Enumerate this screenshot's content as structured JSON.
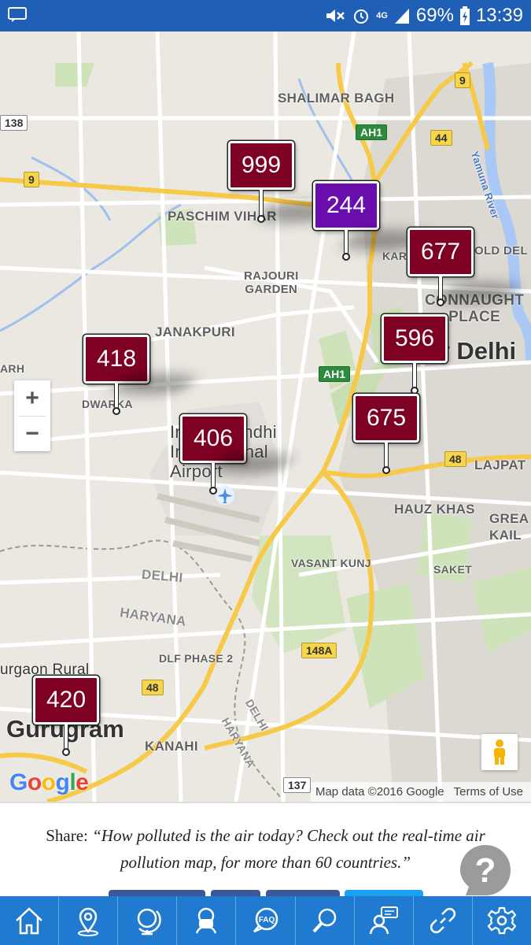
{
  "status_bar": {
    "network": "4G",
    "battery": "69%",
    "time": "13:39",
    "icons": [
      "notification-icon",
      "mute-icon",
      "alarm-icon",
      "signal-icon",
      "battery-charging-icon"
    ]
  },
  "map": {
    "places": {
      "shalimar_bagh": "SHALIMAR BAGH",
      "paschim_vihar": "PASCHIM VIHAR",
      "rajouri_garden": "RAJOURI\nGARDEN",
      "janakpuri": "JANAKPURI",
      "connaught_place": "CONNAUGHT\nPLACE",
      "new_delhi": "New Delhi",
      "dwarka": "DWARKA",
      "airport": "Indira Gandhi\nInternational\nAirport",
      "hauz_khas": "HAUZ KHAS",
      "greater_kailash": "GREA\nKAIL",
      "lajpat": "LAJPAT",
      "vasant_kunj": "VASANT KUNJ",
      "saket": "SAKET",
      "delhi": "DELHI",
      "haryana": "HARYANA",
      "dlf_phase_2": "DLF PHASE 2",
      "gurgaon_rural": "urgaon Rural",
      "gurugram": "Gurugram",
      "kanahi": "KANAHI",
      "delhi_diag": "DELHI",
      "haryana_diag": "HARYANA",
      "old_delhi": "OLD DEL",
      "karol": "KAR",
      "arh": "ARH",
      "yamuna_river": "Yamuna River"
    },
    "road_shields": {
      "r138": "138",
      "r9_left": "9",
      "r9_top": "9",
      "ah1_top": "AH1",
      "ah1_mid": "AH1",
      "r44": "44",
      "r48_right": "48",
      "r48_left": "48",
      "r148a": "148A",
      "r137": "137"
    },
    "aqi_markers": [
      {
        "value": "999",
        "color": "#7e0023"
      },
      {
        "value": "244",
        "color": "#6a0dad"
      },
      {
        "value": "677",
        "color": "#7e0023"
      },
      {
        "value": "596",
        "color": "#7e0023"
      },
      {
        "value": "418",
        "color": "#7e0023"
      },
      {
        "value": "406",
        "color": "#7e0023"
      },
      {
        "value": "675",
        "color": "#7e0023"
      },
      {
        "value": "420",
        "color": "#7e0023"
      }
    ],
    "zoom_in": "+",
    "zoom_out": "−",
    "google_logo": [
      "G",
      "o",
      "o",
      "g",
      "l",
      "e"
    ],
    "map_data": "Map data ©2016 Google",
    "terms": "Terms of Use"
  },
  "share": {
    "prefix": "Share: ",
    "quote": "“How polluted is the air today? Check out the real-time air pollution map, for more than 60 countries.”"
  },
  "help_icon": "?",
  "nav": [
    {
      "name": "home-icon"
    },
    {
      "name": "location-icon"
    },
    {
      "name": "globe-icon"
    },
    {
      "name": "mask-icon"
    },
    {
      "name": "faq-icon",
      "label": "FAQ"
    },
    {
      "name": "search-icon"
    },
    {
      "name": "chat-icon"
    },
    {
      "name": "link-icon"
    },
    {
      "name": "settings-icon"
    }
  ]
}
